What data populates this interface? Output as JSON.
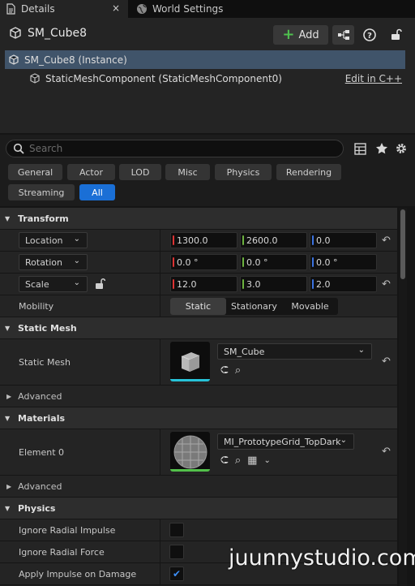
{
  "tabs": {
    "details": "Details",
    "world_settings": "World Settings",
    "close_glyph": "×"
  },
  "header": {
    "actor_name": "SM_Cube8",
    "add_label": "Add",
    "add_glyph": "+",
    "help_glyph": "?"
  },
  "tree": {
    "instance": "SM_Cube8 (Instance)",
    "component": "StaticMeshComponent (StaticMeshComponent0)",
    "edit_link": "Edit in C++"
  },
  "search": {
    "placeholder": "Search"
  },
  "categories": [
    "General",
    "Actor",
    "LOD",
    "Misc",
    "Physics",
    "Rendering",
    "Streaming",
    "All"
  ],
  "active_category": "All",
  "sections": {
    "transform": "Transform",
    "static_mesh": "Static Mesh",
    "materials": "Materials",
    "physics": "Physics",
    "advanced": "Advanced"
  },
  "transform": {
    "location_label": "Location",
    "rotation_label": "Rotation",
    "scale_label": "Scale",
    "mobility_label": "Mobility",
    "location": {
      "x": "1300.0",
      "y": "2600.0",
      "z": "0.0"
    },
    "rotation": {
      "x": "0.0 °",
      "y": "0.0 °",
      "z": "0.0 °"
    },
    "scale": {
      "x": "12.0",
      "y": "3.0",
      "z": "2.0"
    },
    "mobility_options": [
      "Static",
      "Stationary",
      "Movable"
    ],
    "mobility_selected": "Static"
  },
  "static_mesh": {
    "label": "Static Mesh",
    "asset": "SM_Cube"
  },
  "materials": {
    "element_label": "Element 0",
    "asset": "MI_PrototypeGrid_TopDark"
  },
  "physics": {
    "ignore_radial_impulse": {
      "label": "Ignore Radial Impulse",
      "checked": false
    },
    "ignore_radial_force": {
      "label": "Ignore Radial Force",
      "checked": false
    },
    "apply_impulse_on_damage": {
      "label": "Apply Impulse on Damage",
      "checked": true
    }
  },
  "watermark": "juunnystudio.com",
  "colors": {
    "accent_blue": "#1a6fd6",
    "selection": "#40546a",
    "add_green": "#4fc04f",
    "axis_x": "#dd3333",
    "axis_y": "#6db33f",
    "axis_z": "#3b73e0",
    "mesh_underline": "#27c3d8",
    "material_underline": "#52c14a"
  }
}
